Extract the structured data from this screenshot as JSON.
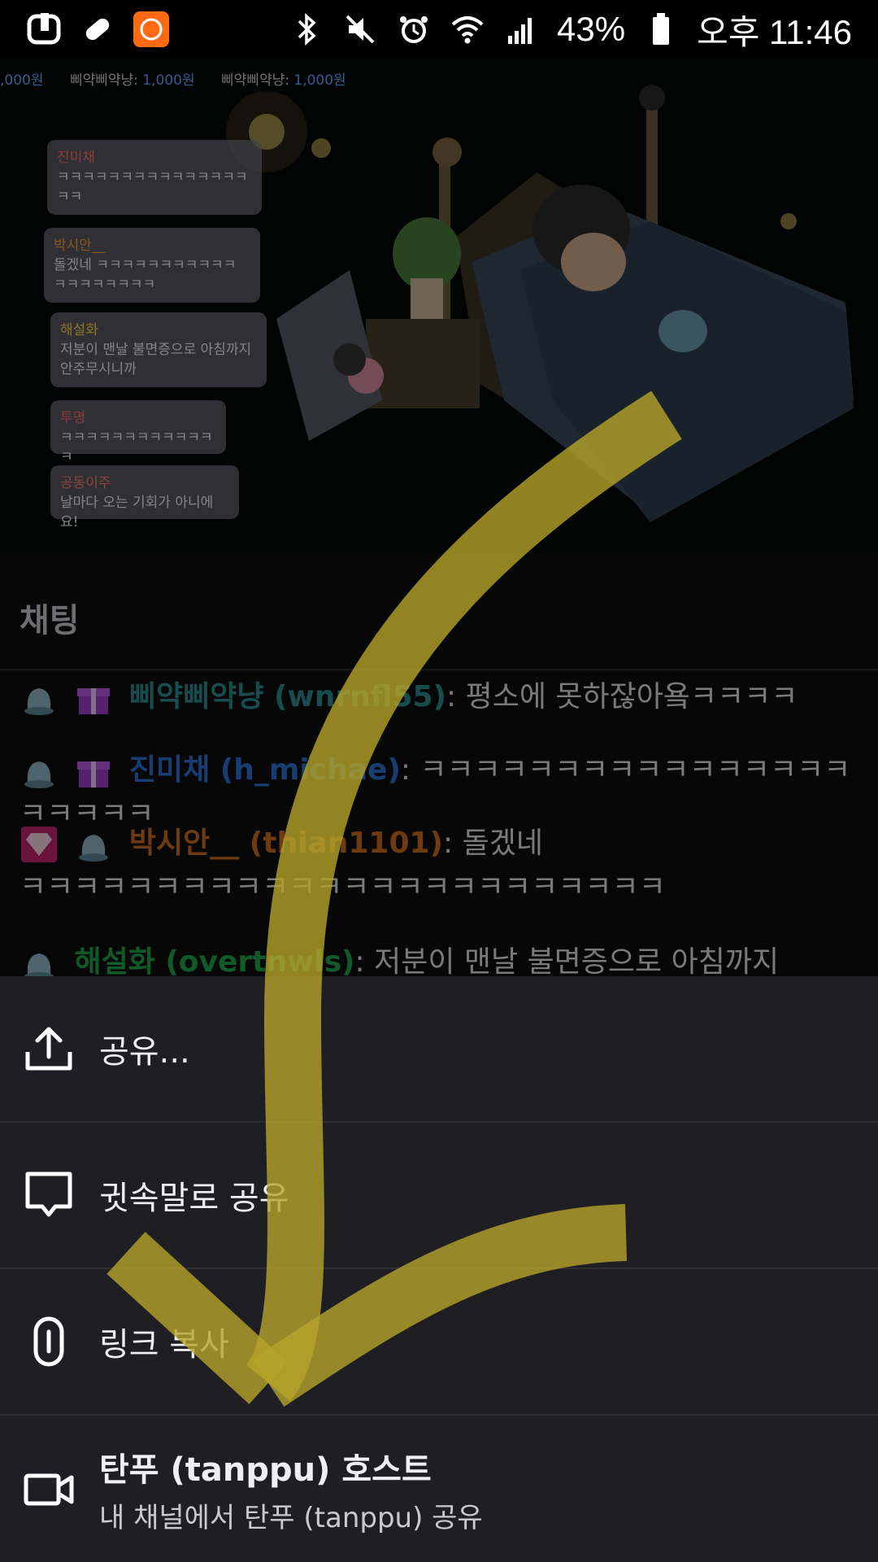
{
  "status_bar": {
    "battery_percent": "43%",
    "time": "오후 11:46"
  },
  "stream": {
    "ticker": [
      {
        "name": "",
        "amount": ",000원"
      },
      {
        "name": "삐약삐약냥:",
        "amount": "1,000원"
      },
      {
        "name": "삐약삐약냥:",
        "amount": "1,000원"
      }
    ],
    "bubbles": [
      {
        "name": "진미채",
        "msg": "ㅋㅋㅋㅋㅋㅋㅋㅋㅋㅋㅋㅋㅋㅋㅋㅋㅋ"
      },
      {
        "name": "박시안__",
        "msg": "돌겠네 ㅋㅋㅋㅋㅋㅋㅋㅋㅋㅋㅋ ㅋㅋㅋㅋㅋㅋㅋㅋ"
      },
      {
        "name": "해설화",
        "msg": "저분이 맨날 불면증으로 아침까지 안주무시니까"
      },
      {
        "name": "투명",
        "msg": "ㅋㅋㅋㅋㅋㅋㅋㅋㅋㅋㅋㅋㅋ"
      },
      {
        "name": "공동이주",
        "msg": "날마다 오는 기회가 아니에요!"
      }
    ]
  },
  "chat": {
    "title": "채팅",
    "messages": [
      {
        "user": "삐약삐약냥 (wnrnfl55)",
        "sep": ": ",
        "text": "평소에 못하잖아욬ㅋㅋㅋㅋ",
        "color": "#2f8a8a"
      },
      {
        "user": "진미채 (h_michae)",
        "sep": ": ",
        "text": "ㅋㅋㅋㅋㅋㅋㅋㅋㅋㅋㅋㅋㅋㅋㅋㅋㅋㅋㅋㅋㅋ",
        "color": "#2a6fd1"
      },
      {
        "user": "박시안__ (thian1101)",
        "sep": ": ",
        "text": "돌겠네",
        "text2": "ㅋㅋㅋㅋㅋㅋㅋㅋㅋㅋㅋㅋㅋㅋㅋㅋㅋㅋㅋㅋㅋㅋㅋㅋ",
        "color": "#c96a1d"
      },
      {
        "user": "해설화 (overtnwls)",
        "sep": ": ",
        "text": "저분이 맨날 불면증으로 아침까지",
        "color": "#1fa34a"
      }
    ]
  },
  "sheet": {
    "share_label": "공유...",
    "whisper_label": "귓속말로 공유",
    "copy_link_label": "링크 복사",
    "host_title": "탄푸 (tanppu) 호스트",
    "host_subtitle": "내 채널에서 탄푸 (tanppu) 공유"
  },
  "icons": {
    "share": "share-upload-icon",
    "whisper": "speech-bubble-icon",
    "link": "link-icon",
    "host": "video-camera-icon"
  },
  "colors": {
    "annotation_arrow": "#b5a42a",
    "sheet_bg": "#1f1f23",
    "chat_bg": "#0e0e10"
  }
}
